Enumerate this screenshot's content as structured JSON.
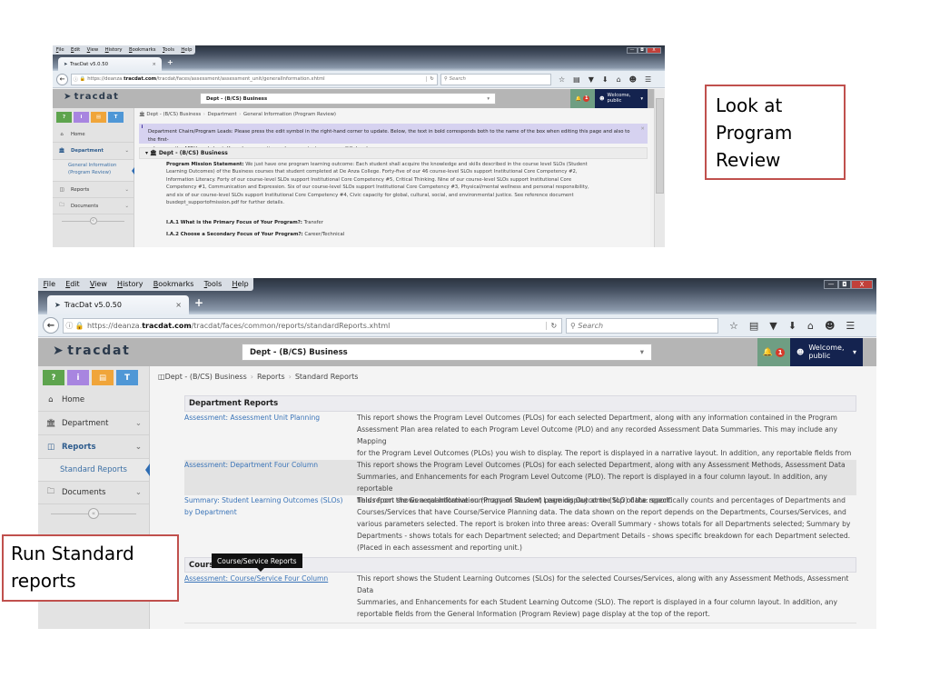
{
  "callouts": {
    "top": [
      "Look at",
      "Program",
      "Review"
    ],
    "bottom": [
      "Run Standard",
      "reports"
    ]
  },
  "browser": {
    "menu": [
      "File",
      "Edit",
      "View",
      "History",
      "Bookmarks",
      "Tools",
      "Help"
    ],
    "tab_title": "TracDat v5.0.50",
    "tab_close": "×",
    "new_tab": "+",
    "search_placeholder": "Search",
    "window_controls": [
      "—",
      "◘",
      "X"
    ]
  },
  "app": {
    "logo": "tracdat",
    "dept_selected": "Dept - (B/CS) Business",
    "notification_count": "1",
    "welcome_line1": "Welcome,",
    "welcome_line2": "public",
    "quick_buttons": [
      "?",
      "i",
      "▤",
      "T"
    ],
    "colors": {
      "accent_blue": "#2f6db3",
      "header_navy": "#14234f",
      "bell_green": "#6f9e83",
      "badge_red": "#d63a2a",
      "callout_border": "#c0504d"
    }
  },
  "shot1": {
    "url_prefix": "https://deanza.",
    "url_host": "tracdat.com",
    "url_path": "/tracdat/faces/assessment/assessment_unit/generalInformation.xhtml",
    "sidebar": {
      "home": "Home",
      "department": "Department",
      "sub_general_info_1": "General Information",
      "sub_general_info_2": "(Program Review)",
      "reports": "Reports",
      "documents": "Documents"
    },
    "breadcrumb": [
      "Dept - (B/CS) Business",
      "Department",
      "General Information (Program Review)"
    ],
    "notice_line1": "Department Chairs/Program Leads: Please press the edit symbol in the right-hand corner to update. Below, the text in bold corresponds both to the name of the box when editing this page and also to the first-",
    "notice_line2": "column on the APRU worksheet. If you have questions, please contact: papemary@fhda.edu.",
    "section_title": "Dept - (B/CS) Business",
    "mission_label": "Program Mission Statement:",
    "mission_lines": [
      " We just have one program learning outcome: Each student shall acquire the knowledge and skills described in the course level SLOs (Student",
      "Learning Outcomes) of the Business courses that student completed at De Anza College.  Forty-five of our 46 course-level SLOs support Institutional Core Competency #2,",
      "Information Literacy.  Forty of our course-level SLOs support Institutional Core Competency #5, Critical Thinking.  Nine of our course-level SLOs support Institutional Core",
      "Competency #1, Communication and Expression.  Six of our course-level SLOs support Institutional Core Competency #3, Physical/mental wellness and personal responsibility,",
      "and six of our course-level SLOs support Institutional Core Competency #4, Civic capacity for global, cultural, social, and environmental justice.  See reference document",
      "busdept_supportofmission.pdf for further details."
    ],
    "q1_label": "I.A.1 What is the Primary Focus of Your Program?:",
    "q1_value": " Transfer",
    "q2_label": "I.A.2 Choose a Secondary Focus of Your Program?:",
    "q2_value": " Career/Technical"
  },
  "shot2": {
    "url_prefix": "https://deanza.",
    "url_host": "tracdat.com",
    "url_path": "/tracdat/faces/common/reports/standardReports.xhtml",
    "sidebar": {
      "home": "Home",
      "department": "Department",
      "reports": "Reports",
      "sub_standard_reports": "Standard Reports",
      "documents": "Documents"
    },
    "breadcrumb": [
      "Dept - (B/CS) Business",
      "Reports",
      "Standard Reports"
    ],
    "dept_reports_header": "Department Reports",
    "dept_reports": [
      {
        "link_lines": [
          "Assessment: Assessment Unit Planning"
        ],
        "desc_lines": [
          "This report shows the Program Level Outcomes (PLOs) for each selected Department, along with any information contained in the Program",
          "Assessment Plan area related to each Program Level Outcome (PLO) and any recorded Assessment Data Summaries. This may include any Mapping",
          "for the Program Level Outcomes (PLOs) you wish to display. The report is displayed in a narrative layout. In addition, any reportable fields from",
          "the General Information (Program Review) page display at the top of the report."
        ]
      },
      {
        "link_lines": [
          "Assessment: Department Four Column"
        ],
        "desc_lines": [
          "This report shows the Program Level Outcomes (PLOs) for each selected Department, along with any Assessment Methods, Assessment Data",
          "Summaries, and Enhancements for each Program Level Outcome (PLO). The report is displayed in a four column layout. In addition, any reportable",
          "fields from the General Information (Program Review) page display at the top of the report."
        ]
      },
      {
        "link_lines": [
          "Summary: Student Learning Outcomes (SLOs)",
          "by Department"
        ],
        "desc_lines": [
          "This report shows a quantitative summary of Student Learning Outcome (SLO) data: specifically counts and percentages of Departments and",
          "Courses/Services that have Course/Service Planning data. The data shown on the report depends on the Departments, Courses/Services, and",
          "various parameters selected. The report is broken into three areas: Overall Summary - shows totals for all Departments selected; Summary by",
          "Departments - shows totals for each Department selected; and Department Details - shows specific breakdown for each Department selected.",
          "(Placed in each assessment and reporting unit.)"
        ]
      }
    ],
    "course_reports_header": "Cours",
    "tooltip": "Course/Service Reports",
    "course_reports": [
      {
        "link_lines": [
          "Assessment: Course/Service Four Column"
        ],
        "desc_lines": [
          "This report shows the Student Learning Outcomes (SLOs) for the selected Courses/Services, along with any Assessment Methods, Assessment Data",
          "Summaries, and Enhancements for each Student Learning Outcome (SLO). The report is displayed in a four column layout. In addition, any",
          "reportable fields from the General Information (Program Review) page display at the top of the report."
        ]
      }
    ]
  }
}
